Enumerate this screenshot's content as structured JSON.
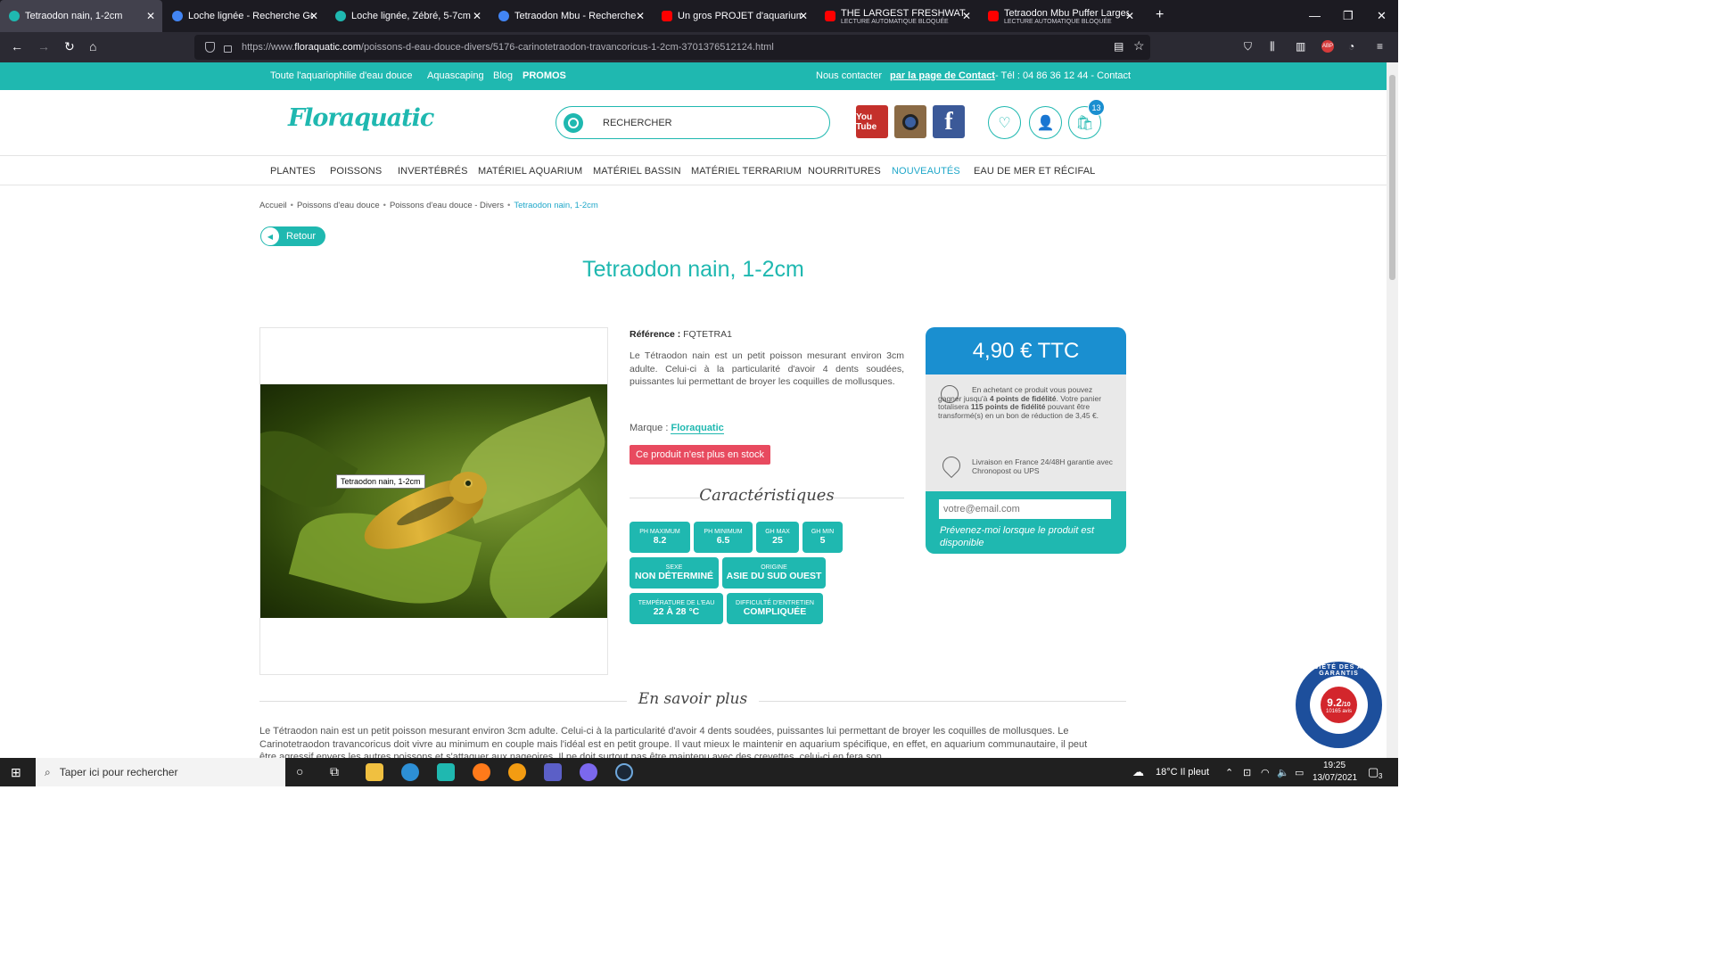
{
  "browser": {
    "tabs": [
      {
        "title": "Tetraodon nain, 1-2cm",
        "sub": "",
        "icon_color": "#1fb8b0",
        "close": "✕"
      },
      {
        "title": "Loche lignée - Recherche Google",
        "sub": "",
        "icon_color": "#4285f4",
        "close": "✕"
      },
      {
        "title": "Loche lignée, Zébré, 5-7cm",
        "sub": "",
        "icon_color": "#1fb8b0",
        "close": "✕"
      },
      {
        "title": "Tetraodon Mbu - Recherche Google",
        "sub": "",
        "icon_color": "#4285f4",
        "close": "✕"
      },
      {
        "title": "Un gros PROJET d'aquarium pour",
        "sub": "",
        "icon_color": "#ff0000",
        "close": "✕"
      },
      {
        "title": "THE LARGEST FRESHWATER PUF",
        "sub": "LECTURE AUTOMATIQUE BLOQUÉE",
        "icon_color": "#ff0000",
        "close": "✕"
      },
      {
        "title": "Tetraodon Mbu Puffer Largest F",
        "sub": "LECTURE AUTOMATIQUE BLOQUÉE",
        "icon_color": "#ff0000",
        "close": "✕"
      }
    ],
    "new_tab": "+",
    "url_prefix": "https://www.",
    "url_host": "floraquatic.com",
    "url_path": "/poissons-d-eau-douce-divers/5176-carinotetraodon-travancoricus-1-2cm-3701376512124.html"
  },
  "topbar": {
    "links": [
      "Toute l'aquariophilie d'eau douce",
      "Aquascaping",
      "Blog",
      "PROMOS"
    ],
    "contact_prefix": "Nous contacter",
    "contact_link": "par la page de Contact ",
    "contact_suffix": "- Tél : 04 86 36 12 44 - Contact"
  },
  "header": {
    "logo": "Floraquatic",
    "search_placeholder": "RECHERCHER",
    "social": {
      "youtube": "You Tube",
      "facebook": "f"
    },
    "cart_count": "13"
  },
  "menu": [
    "PLANTES",
    "POISSONS",
    "INVERTÉBRÉS",
    "MATÉRIEL AQUARIUM",
    "MATÉRIEL BASSIN",
    "MATÉRIEL TERRARIUM",
    "NOURRITURES",
    "NOUVEAUTÉS",
    "EAU DE MER ET RÉCIFAL"
  ],
  "breadcrumb": [
    "Accueil",
    "Poissons d'eau douce",
    "Poissons d'eau douce - Divers",
    "Tetraodon nain, 1-2cm"
  ],
  "retour": "Retour",
  "product": {
    "title": "Tetraodon nain, 1-2cm",
    "image_tooltip": "Tetraodon nain, 1-2cm",
    "reference_label": "Référence :",
    "reference": "FQTETRA1",
    "description": "Le Tétraodon nain est un petit poisson mesurant environ 3cm adulte. Celui-ci à la particularité d'avoir 4 dents soudées, puissantes lui permettant de broyer les coquilles de mollusques.",
    "brand_label": "Marque :",
    "brand": "Floraquatic",
    "stock": "Ce produit n'est plus en stock",
    "caract_title": "Caractéristiques",
    "characteristics": [
      {
        "label": "PH MAXIMUM",
        "value": "8.2"
      },
      {
        "label": "PH MINIMUM",
        "value": "6.5"
      },
      {
        "label": "GH MAX",
        "value": "25"
      },
      {
        "label": "GH MIN",
        "value": "5"
      },
      {
        "label": "SEXE",
        "value": "NON DÉTERMINÉ"
      },
      {
        "label": "ORIGINE",
        "value": "ASIE DU SUD OUEST"
      },
      {
        "label": "TEMPÉRATURE DE L'EAU",
        "value": "22 À 28 °C"
      },
      {
        "label": "DIFFICULTÉ D'ENTRETIEN",
        "value": "COMPLIQUÉE"
      }
    ]
  },
  "pricebox": {
    "price": "4,90 € TTC",
    "loyalty_1": "En achetant ce produit vous pouvez gagner jusqu'à ",
    "loyalty_points": "4 points de fidélité",
    "loyalty_2": ". Votre panier totalisera ",
    "loyalty_total": "115 points de fidélité",
    "loyalty_3": " pouvant être transformé(s) en un bon de réduction de 3,45 €.",
    "delivery": "Livraison en France 24/48H garantie avec Chronopost ou UPS",
    "email_placeholder": "votre@email.com",
    "notify": "Prévenez-moi lorsque le produit est disponible"
  },
  "savoir": {
    "title": "En savoir plus",
    "text": "Le Tétraodon nain est un petit poisson mesurant environ 3cm adulte. Celui-ci à la particularité d'avoir 4 dents soudées, puissantes lui permettant de broyer les coquilles de mollusques. Le Carinotetraodon travancoricus doit vivre au minimum en couple mais l'idéal est en petit groupe. Il vaut mieux le maintenir en aquarium spécifique, en effet, en aquarium communautaire, il peut être agressif envers les autres poissons et s'attaquer aux nageoires. Il ne doit surtout pas être maintenu avec des crevettes, celui-ci en fera son"
  },
  "badge": {
    "ring": "SOCIÉTÉ DES AVIS GARANTIS",
    "score": "9.2",
    "out_of": "/10",
    "count": "10165 avis"
  },
  "taskbar": {
    "search": "Taper ici pour rechercher",
    "weather": "18°C  Il pleut",
    "time": "19:25",
    "date": "13/07/2021",
    "notif_count": "3"
  }
}
